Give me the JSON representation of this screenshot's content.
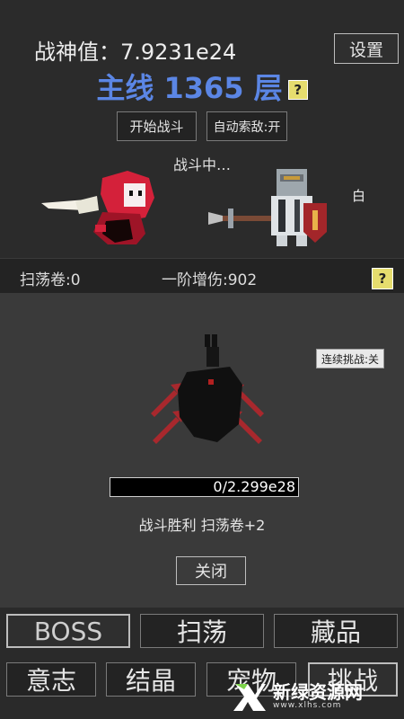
{
  "header": {
    "power_label": "战神值：7.9231e24",
    "settings_label": "设置",
    "floor_label": "主线 1365 层",
    "help_mark": "?"
  },
  "controls": {
    "start_battle_label": "开始战斗",
    "auto_target_label": "自动索敌:开"
  },
  "battle": {
    "status_text": "战斗中…",
    "enemy_label": "白"
  },
  "info_bar": {
    "sweep_scrolls": "扫荡卷:0",
    "damage_bonus": "一阶增伤:902",
    "help_mark": "?"
  },
  "boss_panel": {
    "continuous_challenge_label": "连续挑战:关",
    "hp_text": "0/2.299e28",
    "hp_fraction": 0,
    "result_text": "战斗胜利 扫荡卷+2",
    "close_label": "关闭"
  },
  "nav": {
    "boss": "BOSS",
    "sweep": "扫荡",
    "collection": "藏品",
    "will": "意志",
    "crystal": "结晶",
    "pet": "宠物",
    "challenge": "挑战"
  },
  "watermark": {
    "title": "新绿资源网",
    "url": "www.xlhs.com"
  },
  "colors": {
    "floor_blue": "#5b86e5",
    "help_yellow": "#e6dd6e",
    "hero_red": "#d4213a",
    "spear_red": "#a8282d"
  }
}
